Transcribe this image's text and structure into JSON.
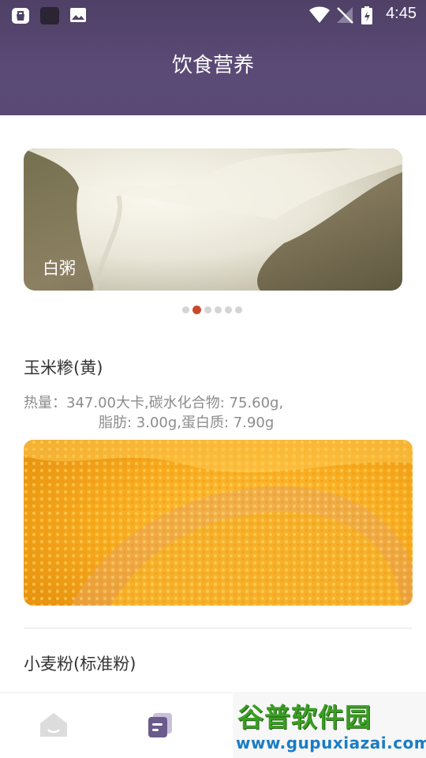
{
  "status_bar": {
    "time": "4:45",
    "left_icons": [
      "shopping-bag-icon",
      "square-app-icon",
      "image-icon"
    ],
    "right_icons": [
      "wifi-icon",
      "no-signal-icon",
      "battery-icon"
    ]
  },
  "header": {
    "title": "饮食营养"
  },
  "banner": {
    "caption": "白粥",
    "pages": 6,
    "active_page": 2
  },
  "foods": [
    {
      "name": "玉米糁(黄)",
      "nutrition_line1": "热量：347.00大卡,碳水化合物: 75.60g,",
      "nutrition_line2": "脂肪: 3.00g,蛋白质: 7.90g"
    },
    {
      "name": "小麦粉(标准粉)"
    }
  ],
  "bottom_nav": {
    "items": [
      {
        "icon": "home-icon",
        "active": false
      },
      {
        "icon": "article-icon",
        "active": true
      }
    ]
  },
  "watermark": {
    "logo_text": "谷普软件园",
    "url": "www.gupuxiazai.com"
  },
  "colors": {
    "header_bg": "#564770",
    "dot_active": "#c84a2c",
    "nav_active": "#6b5a8c"
  }
}
